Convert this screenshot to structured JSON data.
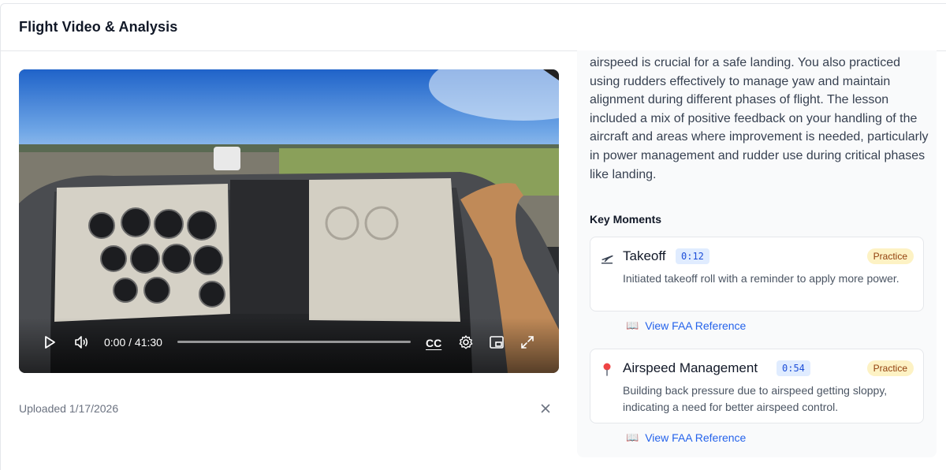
{
  "header": {
    "title": "Flight Video & Analysis"
  },
  "video": {
    "time_display": "0:00 / 41:30",
    "progress_fraction": 0.0,
    "cc_label": "CC",
    "controls": [
      "play-icon",
      "volume-icon",
      "captions-icon",
      "settings-icon",
      "picture-in-picture-icon",
      "fullscreen-icon"
    ]
  },
  "upload": {
    "uploaded_text": "Uploaded 1/17/2026"
  },
  "analysis": {
    "summary_text": "airspeed is crucial for a safe landing. You also practiced using rudders effectively to manage yaw and maintain alignment during different phases of flight. The lesson included a mix of positive feedback on your handling of the aircraft and areas where improvement is needed, particularly in power management and rudder use during critical phases like landing.",
    "key_moments_title": "Key Moments",
    "moments": [
      {
        "icon": "airplane-takeoff-icon",
        "title": "Takeoff",
        "timestamp": "0:12",
        "badge": "Practice",
        "description": "Initiated takeoff roll with a reminder to apply more power.",
        "link_label": "View FAA Reference"
      },
      {
        "icon": "pushpin-icon",
        "title": "Airspeed Management",
        "timestamp": "0:54",
        "badge": "Practice",
        "description": "Building back pressure due to airspeed getting sloppy, indicating a need for better airspeed control.",
        "link_label": "View FAA Reference"
      }
    ]
  },
  "colors": {
    "link": "#2563eb",
    "badge_bg": "#fdf2c4",
    "badge_text": "#92400e",
    "timestamp_bg": "#e0ecff",
    "timestamp_text": "#1d4ed8"
  }
}
